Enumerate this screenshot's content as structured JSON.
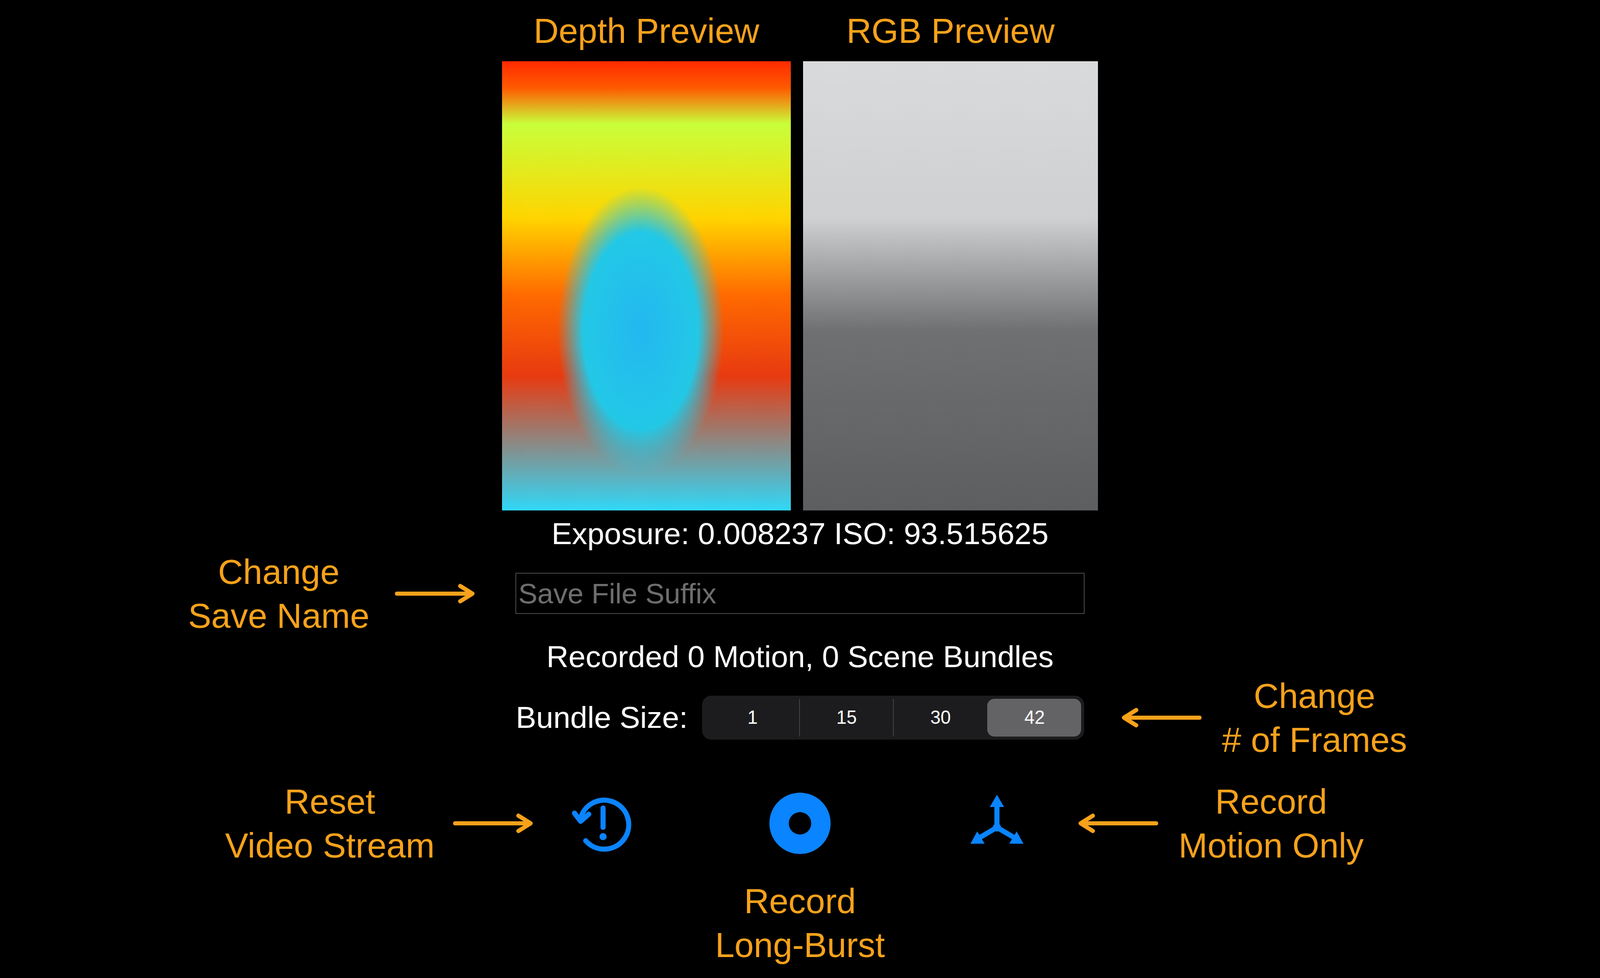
{
  "previews": [
    {
      "label": "Depth Preview",
      "kind": "depth"
    },
    {
      "label": "RGB Preview",
      "kind": "rgb"
    }
  ],
  "exposure": "Exposure: 0.008237 ISO: 93.515625",
  "save_field": {
    "placeholder": "Save File Suffix",
    "annotation": [
      "Change",
      "Save Name"
    ]
  },
  "status": "Recorded 0 Motion, 0 Scene Bundles",
  "bundle_size": {
    "label": "Bundle Size:",
    "annotation": [
      "Change",
      "# of Frames"
    ],
    "options": [
      {
        "label": "1",
        "selected": false
      },
      {
        "label": "15",
        "selected": false
      },
      {
        "label": "30",
        "selected": false
      },
      {
        "label": "42",
        "selected": true
      }
    ]
  },
  "actions": [
    {
      "kind": "reset",
      "annotation": [
        "Reset",
        "Video Stream"
      ],
      "side": "left"
    },
    {
      "kind": "record",
      "annotation": [
        "Record",
        "Long-Burst"
      ],
      "side": "below"
    },
    {
      "kind": "motion",
      "annotation": [
        "Record",
        "Motion Only"
      ],
      "side": "right"
    }
  ]
}
